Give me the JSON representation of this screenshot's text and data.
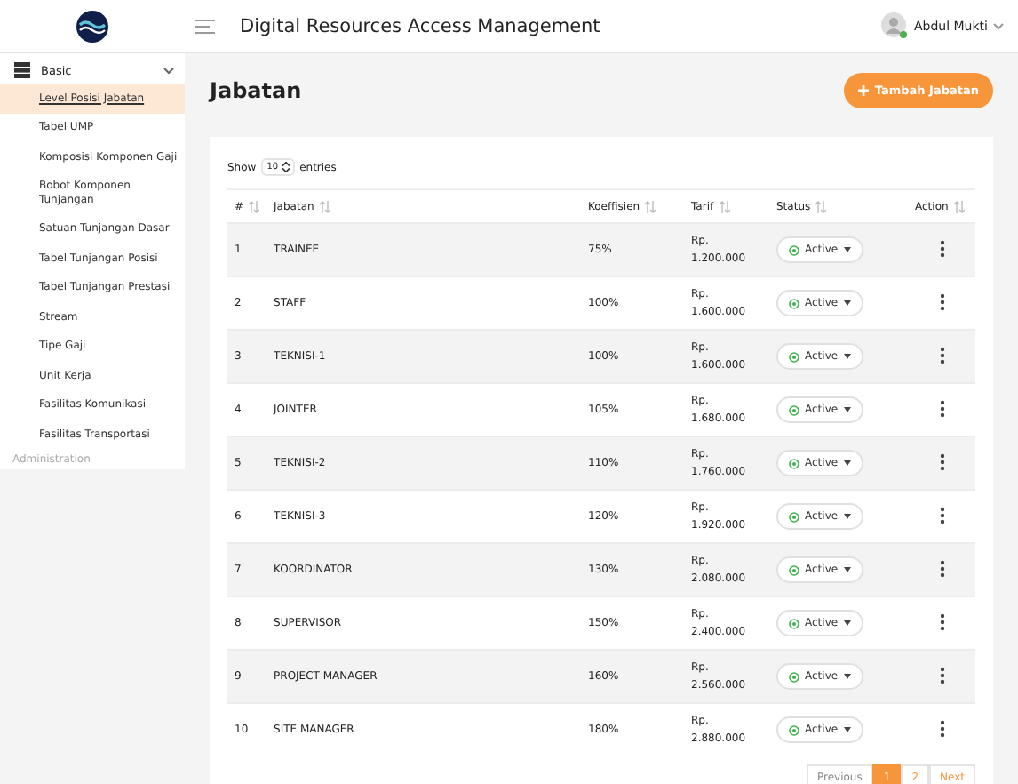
{
  "header": {
    "title": "Digital Resources Access Management",
    "user": "Abdul Mukti"
  },
  "sidebar": {
    "group": {
      "label": "Basic",
      "expanded": true
    },
    "items": [
      {
        "label": "Level Posisi Jabatan",
        "selected": true
      },
      {
        "label": "Tabel UMP",
        "selected": false
      },
      {
        "label": "Komposisi Komponen Gaji",
        "selected": false
      },
      {
        "label": "Bobot Komponen Tunjangan",
        "selected": false
      },
      {
        "label": "Satuan Tunjangan Dasar",
        "selected": false
      },
      {
        "label": "Tabel Tunjangan Posisi",
        "selected": false
      },
      {
        "label": "Tabel Tunjangan Prestasi",
        "selected": false
      },
      {
        "label": "Stream",
        "selected": false
      },
      {
        "label": "Tipe Gaji",
        "selected": false
      },
      {
        "label": "Unit Kerja",
        "selected": false
      },
      {
        "label": "Fasilitas Komunikasi",
        "selected": false
      },
      {
        "label": "Fasilitas Transportasi",
        "selected": false
      }
    ],
    "next_group": "Administration"
  },
  "page": {
    "title": "Jabatan",
    "add_button": "Tambah Jabatan"
  },
  "length": {
    "prefix": "Show",
    "value": "10",
    "suffix": "entries"
  },
  "table": {
    "columns": [
      "#",
      "Jabatan",
      "Koeffisien",
      "Tarif",
      "Status",
      "Action"
    ],
    "rows": [
      {
        "no": "1",
        "jabatan": "TRAINEE",
        "koef": "75%",
        "tarif": [
          "Rp.",
          "1.200.000"
        ],
        "status": "Active"
      },
      {
        "no": "2",
        "jabatan": "STAFF",
        "koef": "100%",
        "tarif": [
          "Rp.",
          "1.600.000"
        ],
        "status": "Active"
      },
      {
        "no": "3",
        "jabatan": "TEKNISI-1",
        "koef": "100%",
        "tarif": [
          "Rp.",
          "1.600.000"
        ],
        "status": "Active"
      },
      {
        "no": "4",
        "jabatan": "JOINTER",
        "koef": "105%",
        "tarif": [
          "Rp.",
          "1.680.000"
        ],
        "status": "Active"
      },
      {
        "no": "5",
        "jabatan": "TEKNISI-2",
        "koef": "110%",
        "tarif": [
          "Rp.",
          "1.760.000"
        ],
        "status": "Active"
      },
      {
        "no": "6",
        "jabatan": "TEKNISI-3",
        "koef": "120%",
        "tarif": [
          "Rp.",
          "1.920.000"
        ],
        "status": "Active"
      },
      {
        "no": "7",
        "jabatan": "KOORDINATOR",
        "koef": "130%",
        "tarif": [
          "Rp.",
          "2.080.000"
        ],
        "status": "Active"
      },
      {
        "no": "8",
        "jabatan": "SUPERVISOR",
        "koef": "150%",
        "tarif": [
          "Rp.",
          "2.400.000"
        ],
        "status": "Active"
      },
      {
        "no": "9",
        "jabatan": "PROJECT MANAGER",
        "koef": "160%",
        "tarif": [
          "Rp.",
          "2.560.000"
        ],
        "status": "Active"
      },
      {
        "no": "10",
        "jabatan": "SITE MANAGER",
        "koef": "180%",
        "tarif": [
          "Rp.",
          "2.880.000"
        ],
        "status": "Active"
      }
    ]
  },
  "pagination": [
    {
      "label": "Previous",
      "selected": false
    },
    {
      "label": "1",
      "selected": true
    },
    {
      "label": "2",
      "selected": false
    },
    {
      "label": "Next",
      "selected": false
    }
  ]
}
